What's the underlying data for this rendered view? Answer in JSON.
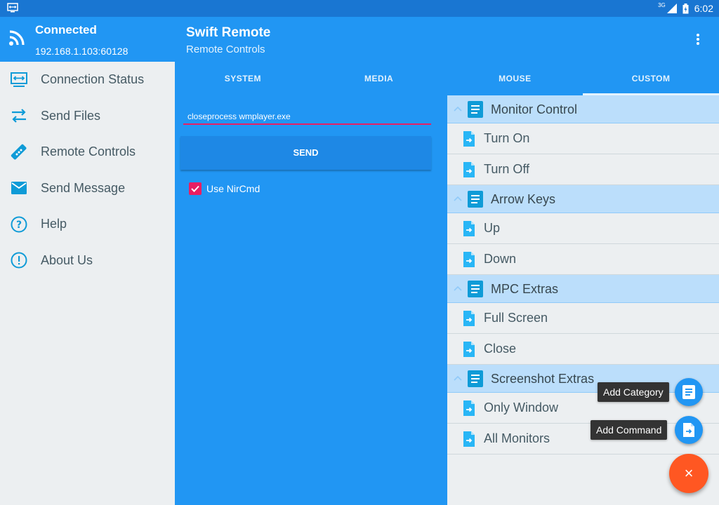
{
  "status_bar": {
    "network": "3G",
    "time": "6:02"
  },
  "drawer": {
    "header": {
      "title": "Connected",
      "subtitle": "192.168.1.103:60128"
    },
    "items": [
      {
        "label": "Connection Status",
        "icon": "monitor-arrows-icon"
      },
      {
        "label": "Send Files",
        "icon": "swap-arrows-icon"
      },
      {
        "label": "Remote Controls",
        "icon": "remote-icon"
      },
      {
        "label": "Send Message",
        "icon": "envelope-icon"
      },
      {
        "label": "Help",
        "icon": "help-circle-icon"
      },
      {
        "label": "About Us",
        "icon": "info-circle-icon"
      }
    ]
  },
  "appbar": {
    "title": "Swift Remote",
    "subtitle": "Remote Controls",
    "tabs": [
      {
        "label": "SYSTEM"
      },
      {
        "label": "MEDIA"
      },
      {
        "label": "MOUSE"
      },
      {
        "label": "CUSTOM",
        "active": true
      }
    ]
  },
  "command_panel": {
    "input_value": "closeprocess wmplayer.exe",
    "send_label": "SEND",
    "checkbox_label": "Use NirCmd",
    "checkbox_checked": true
  },
  "categories": [
    {
      "label": "Monitor Control",
      "items": [
        "Turn On",
        "Turn Off"
      ]
    },
    {
      "label": "Arrow Keys",
      "items": [
        "Up",
        "Down"
      ]
    },
    {
      "label": "MPC Extras",
      "items": [
        "Full Screen",
        "Close"
      ]
    },
    {
      "label": "Screenshot Extras",
      "items": [
        "Only Window",
        "All Monitors"
      ]
    }
  ],
  "fab_menu": {
    "add_category_label": "Add Category",
    "add_command_label": "Add Command",
    "close_symbol": "×"
  },
  "colors": {
    "primary": "#2196f3",
    "primary_dark": "#1976d2",
    "accent_pink": "#e91e63",
    "fab_orange": "#ff5722",
    "category_bg": "#bbdefb"
  }
}
